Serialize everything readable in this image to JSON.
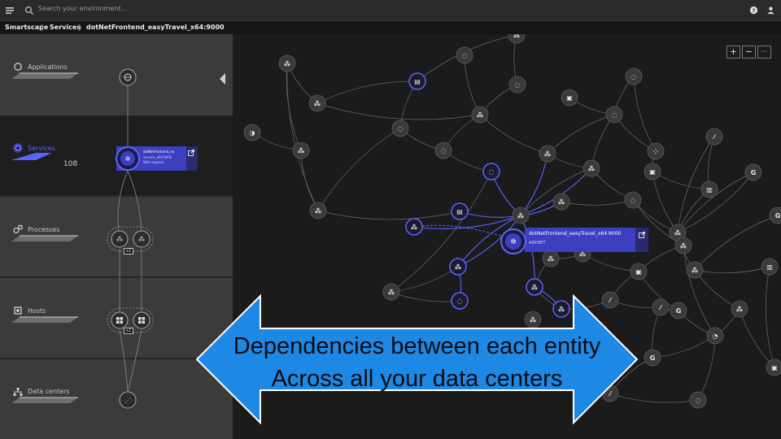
{
  "topbar": {
    "search_placeholder": "Search your environment...",
    "menu_icon": "menu-icon",
    "help_icon": "help-icon",
    "user_icon": "user-icon"
  },
  "breadcrumb": {
    "items": [
      "Smartscape",
      "Services",
      "dotNetFrontend_easyTravel_x64:9000"
    ]
  },
  "sidebar": {
    "categories": [
      {
        "label": "Applications",
        "icon": "applications-icon"
      },
      {
        "label": "Services",
        "icon": "gear-icon",
        "count": "108",
        "active": true
      },
      {
        "label": "Processes",
        "icon": "processes-icon"
      },
      {
        "label": "Hosts",
        "icon": "hosts-icon"
      },
      {
        "label": "Data centers",
        "icon": "datacenter-icon"
      }
    ],
    "service_card": {
      "line1": "dotNetFrontend_ea",
      "line2": "service_x64:9000",
      "line3": "Web request"
    },
    "badges": [
      "x2",
      "x2"
    ]
  },
  "map": {
    "selected": {
      "title": "dotNetFrontend_easyTravel_x64:9000",
      "subtitle": "ASP.NET"
    },
    "zoom": {
      "plus": "+",
      "minus": "−",
      "more": "···"
    }
  },
  "callout": {
    "line1": "Dependencies between each entity",
    "line2": "Across all your data centers",
    "color": "#1e88e5"
  },
  "colors": {
    "accent": "#5c62ff",
    "card": "#3c3fbf",
    "panel": "#3b3b3b",
    "bg": "#1b1b1b"
  }
}
